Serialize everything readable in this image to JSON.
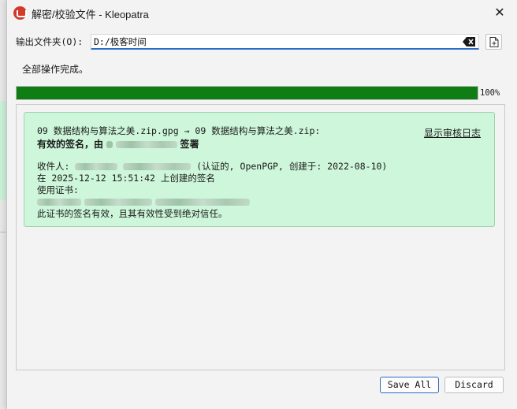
{
  "window": {
    "title": "解密/校验文件 - Kleopatra",
    "close_glyph": "✕"
  },
  "output": {
    "label": "输出文件夹(O):",
    "value": "D:/极客时间"
  },
  "status_text": "全部操作完成。",
  "progress": {
    "percent": 100,
    "label": "100%"
  },
  "result": {
    "file_line": "09 数据结构与算法之美.zip.gpg → 09 数据结构与算法之美.zip:",
    "sig_prefix": "有效的签名，由",
    "sig_suffix": "签署",
    "audit_link": "显示审核日志",
    "recipient_prefix": "收件人:",
    "recipient_suffix": "(认证的, OpenPGP, 创建于: 2022-08-10)",
    "created_line": "在 2025-12-12 15:51:42 上创建的签名",
    "cert_label": "使用证书:",
    "trust_line": "此证书的签名有效，且其有效性受到绝对信任。"
  },
  "buttons": {
    "save_all": "Save All",
    "discard": "Discard"
  },
  "colors": {
    "progress_fill": "#0e7d12",
    "result_bg": "#cdf6da",
    "accent": "#2b6cc4"
  }
}
